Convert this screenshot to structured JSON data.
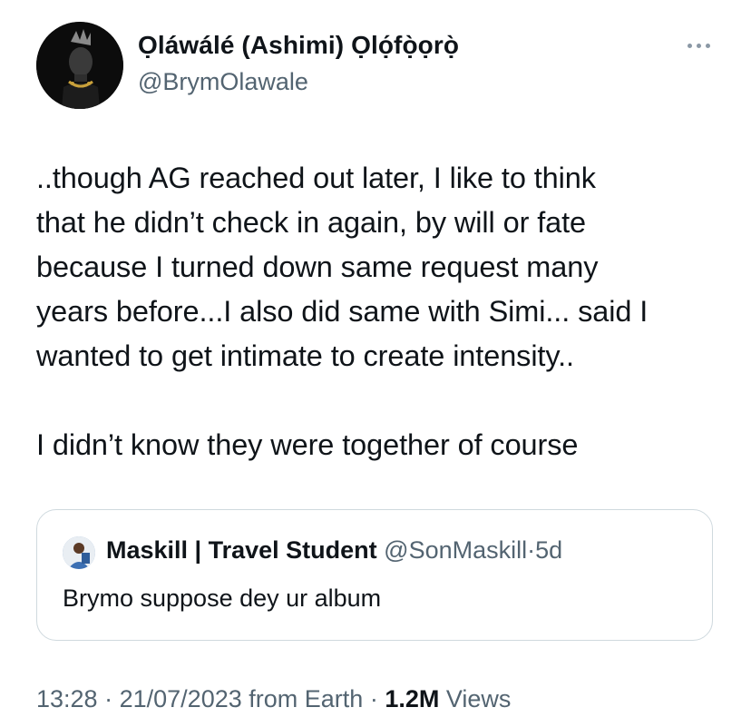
{
  "author": {
    "display_name": "Ọláwálé (Ashimi) Ọlọ́fọ̀ọrọ̀",
    "handle": "@BrymOlawale",
    "avatar_icon": "profile-photo"
  },
  "more_icon": "ellipsis-horizontal-icon",
  "tweet": {
    "text": "..though AG reached out later, I like to think\nthat he didn’t check in again, by will or fate\nbecause I turned down same request many\nyears before...I also did same with Simi... said I\nwanted to get intimate to create intensity..\n\nI didn’t know they were together of course"
  },
  "quote": {
    "name": "Maskill | Travel Student",
    "handle": "@SonMaskill",
    "separator": "·",
    "time": "5d",
    "text": "Brymo suppose dey ur album"
  },
  "meta": {
    "time": "13:28",
    "sep1": "·",
    "date": "21/07/2023",
    "source": "from Earth",
    "sep2": "·",
    "views_count": "1.2M",
    "views_label": "Views"
  },
  "colors": {
    "text_primary": "#0f1419",
    "text_secondary": "#536471",
    "border": "#cfd9de"
  }
}
